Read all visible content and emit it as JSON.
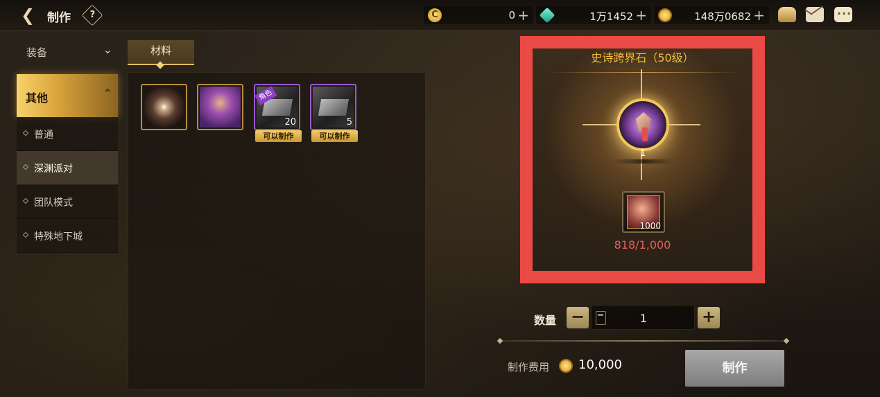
{
  "header": {
    "title": "制作",
    "help_label": "?",
    "currencies": [
      {
        "name": "c-coin",
        "icon": "c-coin-icon",
        "value": "0",
        "plus": "+"
      },
      {
        "name": "gem",
        "icon": "gem-icon",
        "value": "1万1452",
        "plus": "+"
      },
      {
        "name": "gold",
        "icon": "gold-coin-icon",
        "value": "148万0682",
        "plus": "+"
      }
    ]
  },
  "sidebar": {
    "category_equipment": "装备",
    "category_other": "其他",
    "items": [
      {
        "label": "普通",
        "selected": false
      },
      {
        "label": "深渊派对",
        "selected": true
      },
      {
        "label": "团队模式",
        "selected": false
      },
      {
        "label": "特殊地下城",
        "selected": false
      }
    ]
  },
  "materials": {
    "tab_label": "材料",
    "slots": [
      {
        "name": "burst-material",
        "count": "",
        "tag": "",
        "craftable": ""
      },
      {
        "name": "epic-stone",
        "count": "",
        "tag": "",
        "craftable": ""
      },
      {
        "name": "role-card",
        "count": "20",
        "tag": "角色",
        "craftable": "可以制作"
      },
      {
        "name": "card",
        "count": "5",
        "tag": "",
        "craftable": "可以制作"
      }
    ]
  },
  "detail": {
    "title": "史诗跨界石（50级）",
    "result_count": "1",
    "material_count": "1000",
    "material_progress": "818/1,000"
  },
  "quantity": {
    "label": "数量",
    "minus": "−",
    "plus": "+",
    "value": "1"
  },
  "cost": {
    "label": "制作费用",
    "value": "10,000"
  },
  "make_button": "制作",
  "colors": {
    "highlight_frame": "#ea4a45",
    "title_gold": "#f2bb3a",
    "progress_red": "#e25f5f"
  }
}
